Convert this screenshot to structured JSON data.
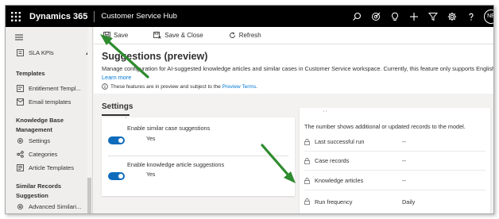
{
  "topnav": {
    "app_name": "Dynamics 365",
    "hub_name": "Customer Service Hub",
    "avatar_initials": "NE",
    "icons": [
      "search-icon",
      "target-icon",
      "lightbulb-icon",
      "plus-icon",
      "filter-icon",
      "gear-icon",
      "help-icon"
    ]
  },
  "sidebar": {
    "top_item": "SLA KPIs",
    "groups": [
      {
        "heading": "Templates",
        "items": [
          "Entitlement Templ...",
          "Email templates"
        ]
      },
      {
        "heading": "Knowledge Base Management",
        "items": [
          "Settings",
          "Categories",
          "Article Templates"
        ]
      },
      {
        "heading": "Similar Records Suggestion",
        "items": [
          "Advanced Similari..."
        ]
      }
    ]
  },
  "commandbar": {
    "save": "Save",
    "save_close": "Save & Close",
    "refresh": "Refresh"
  },
  "page": {
    "title": "Suggestions (preview)",
    "description": "Manage configuration for AI-suggested knowledge articles and similar cases in Customer Service workspace. Currently, this feature only supports English content.",
    "learn_more": "Learn more",
    "notice_text": "These features are in preview and subject to the",
    "notice_link": "Preview Terms",
    "notice_end": "."
  },
  "settings": {
    "tab_label": "Settings",
    "toggles": [
      {
        "label": "Enable similar case suggestions",
        "state": "Yes",
        "on": true
      },
      {
        "label": "Enable knowledge article suggestions",
        "state": "Yes",
        "on": true
      }
    ]
  },
  "status_panel": {
    "subtitle": "The number shows additional or updated records to the model.",
    "rows": [
      {
        "label": "Last successful run",
        "value": "--"
      },
      {
        "label": "Case records",
        "value": "--"
      },
      {
        "label": "Knowledge articles",
        "value": "--"
      },
      {
        "label": "Run frequency",
        "value": "Daily"
      }
    ]
  },
  "colors": {
    "nav_bg": "#000000",
    "accent": "#0f6cbd",
    "link": "#0078d4",
    "arrow": "#2e8b2e"
  }
}
